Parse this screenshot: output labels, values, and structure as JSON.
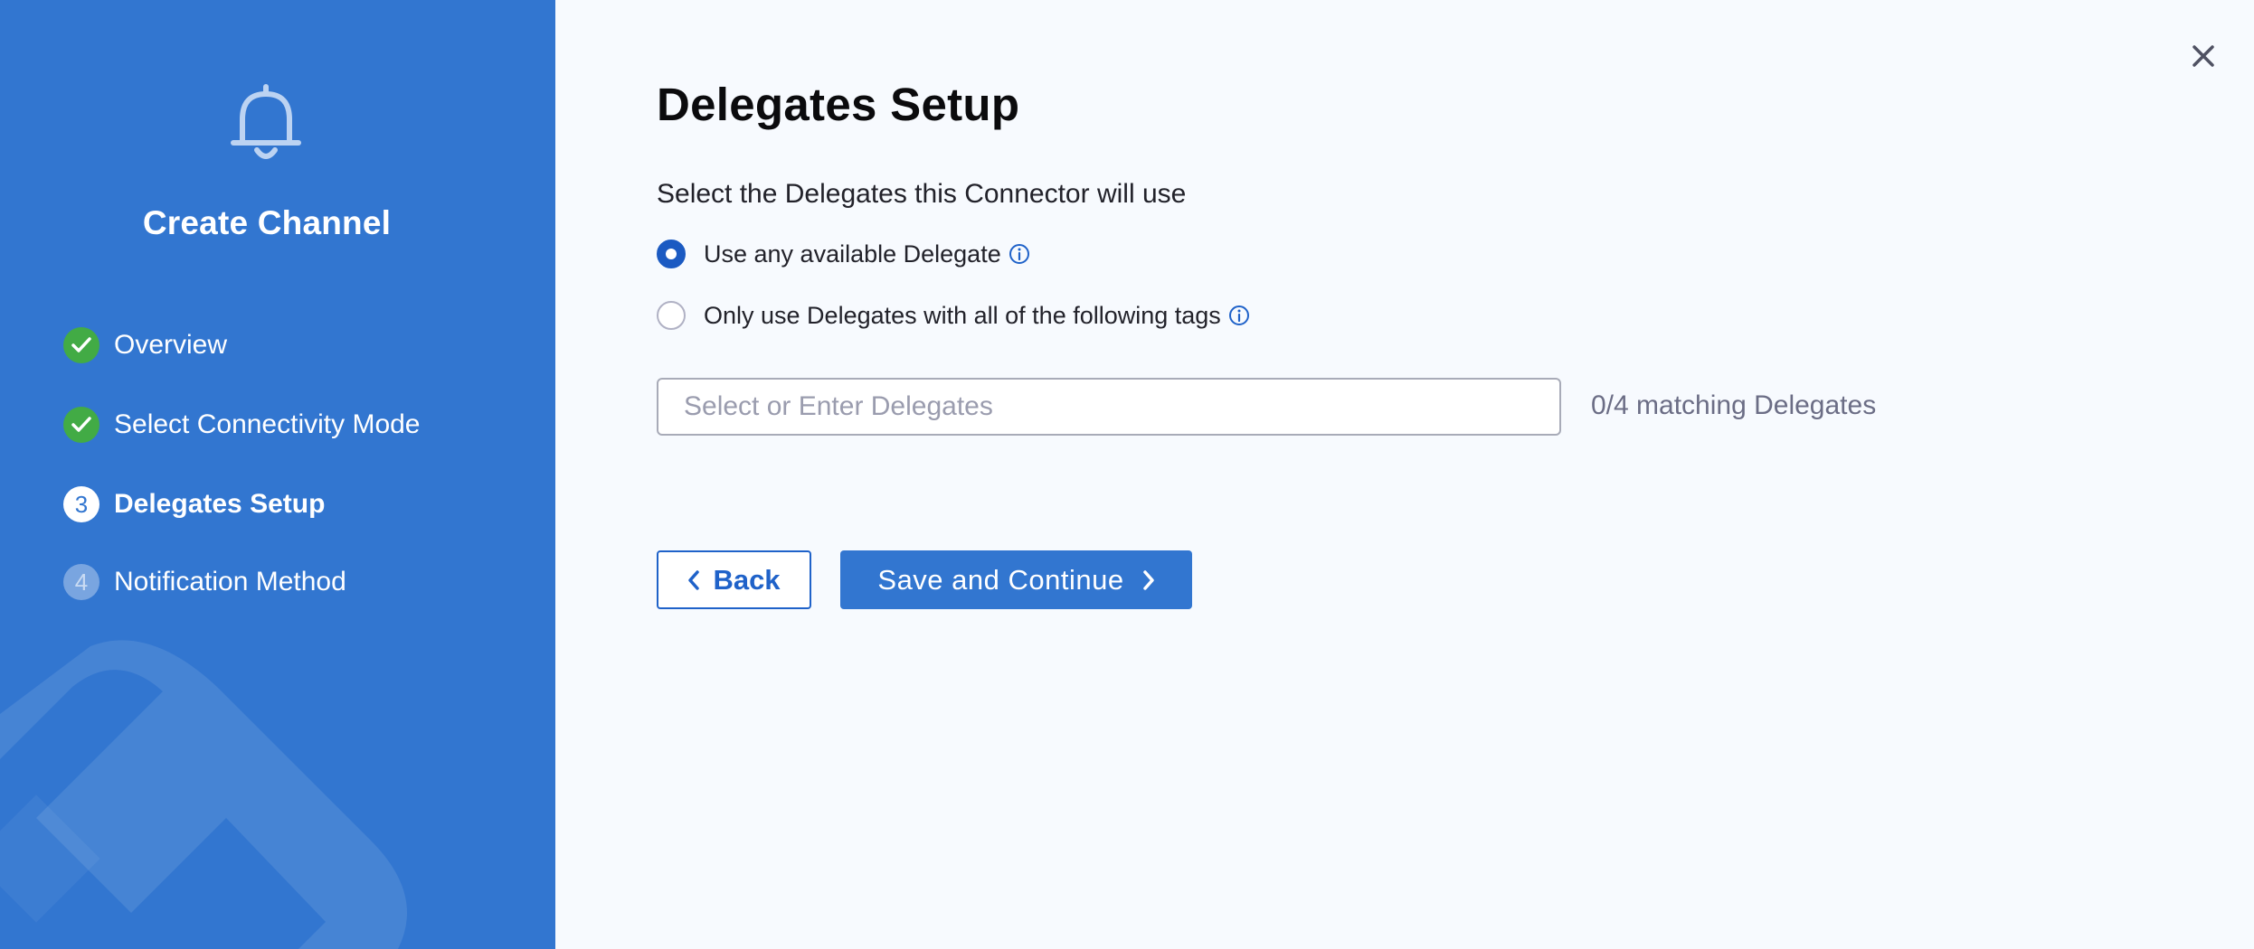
{
  "sidebar": {
    "icon": "bell-icon",
    "title": "Create Channel",
    "steps": [
      {
        "label": "Overview",
        "state": "done",
        "marker": ""
      },
      {
        "label": "Select Connectivity Mode",
        "state": "done",
        "marker": ""
      },
      {
        "label": "Delegates Setup",
        "state": "current",
        "marker": "3"
      },
      {
        "label": "Notification Method",
        "state": "pending",
        "marker": "4"
      }
    ]
  },
  "main": {
    "heading": "Delegates Setup",
    "subheading": "Select the Delegates this Connector will use",
    "options": [
      {
        "label": "Use any available Delegate",
        "checked": true
      },
      {
        "label": "Only use Delegates with all of the following tags",
        "checked": false
      }
    ],
    "delegate_input": {
      "placeholder": "Select or Enter Delegates",
      "value": ""
    },
    "matching_text": "0/4 matching Delegates",
    "back_label": "Back",
    "save_label": "Save and Continue"
  },
  "colors": {
    "sidebar_bg": "#3276d0",
    "accent": "#1f62c9",
    "step_done": "#42ab45",
    "page_bg": "#f7fafe"
  }
}
